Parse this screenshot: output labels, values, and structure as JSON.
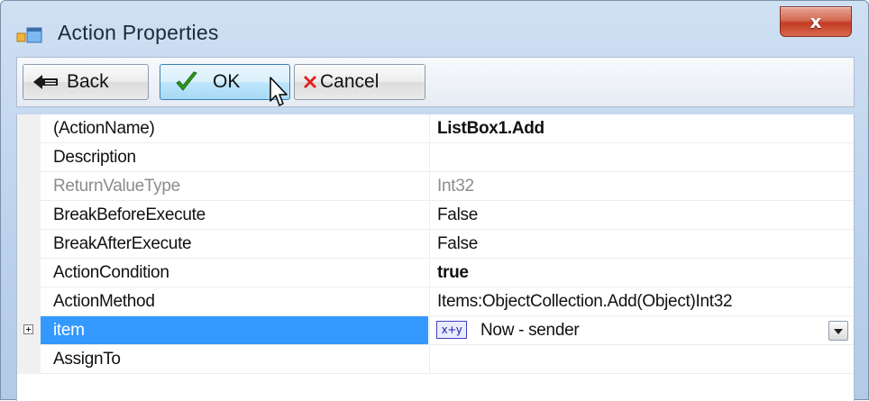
{
  "window": {
    "title": "Action Properties",
    "close_glyph": "x"
  },
  "toolbar": {
    "back_label": "Back",
    "ok_label": "OK",
    "cancel_label": "Cancel"
  },
  "properties": [
    {
      "name": "(ActionName)",
      "value": "ListBox1.Add",
      "value_bold": true
    },
    {
      "name": "Description",
      "value": ""
    },
    {
      "name": "ReturnValueType",
      "value": "Int32",
      "readonly": true
    },
    {
      "name": "BreakBeforeExecute",
      "value": "False"
    },
    {
      "name": "BreakAfterExecute",
      "value": "False"
    },
    {
      "name": "ActionCondition",
      "value": "true",
      "value_bold": true
    },
    {
      "name": "ActionMethod",
      "value": "Items:ObjectCollection.Add(Object)Int32"
    },
    {
      "name": "item",
      "value": "Now - sender",
      "selected": true,
      "expandable": true,
      "value_icon": "math-expression-icon",
      "value_icon_text": "x+y"
    },
    {
      "name": "AssignTo",
      "value": ""
    }
  ],
  "colors": {
    "selection": "#3399ff",
    "close_button": "#c23b22",
    "ok_check": "#2e9a1f",
    "cancel_x": "#e02020"
  }
}
